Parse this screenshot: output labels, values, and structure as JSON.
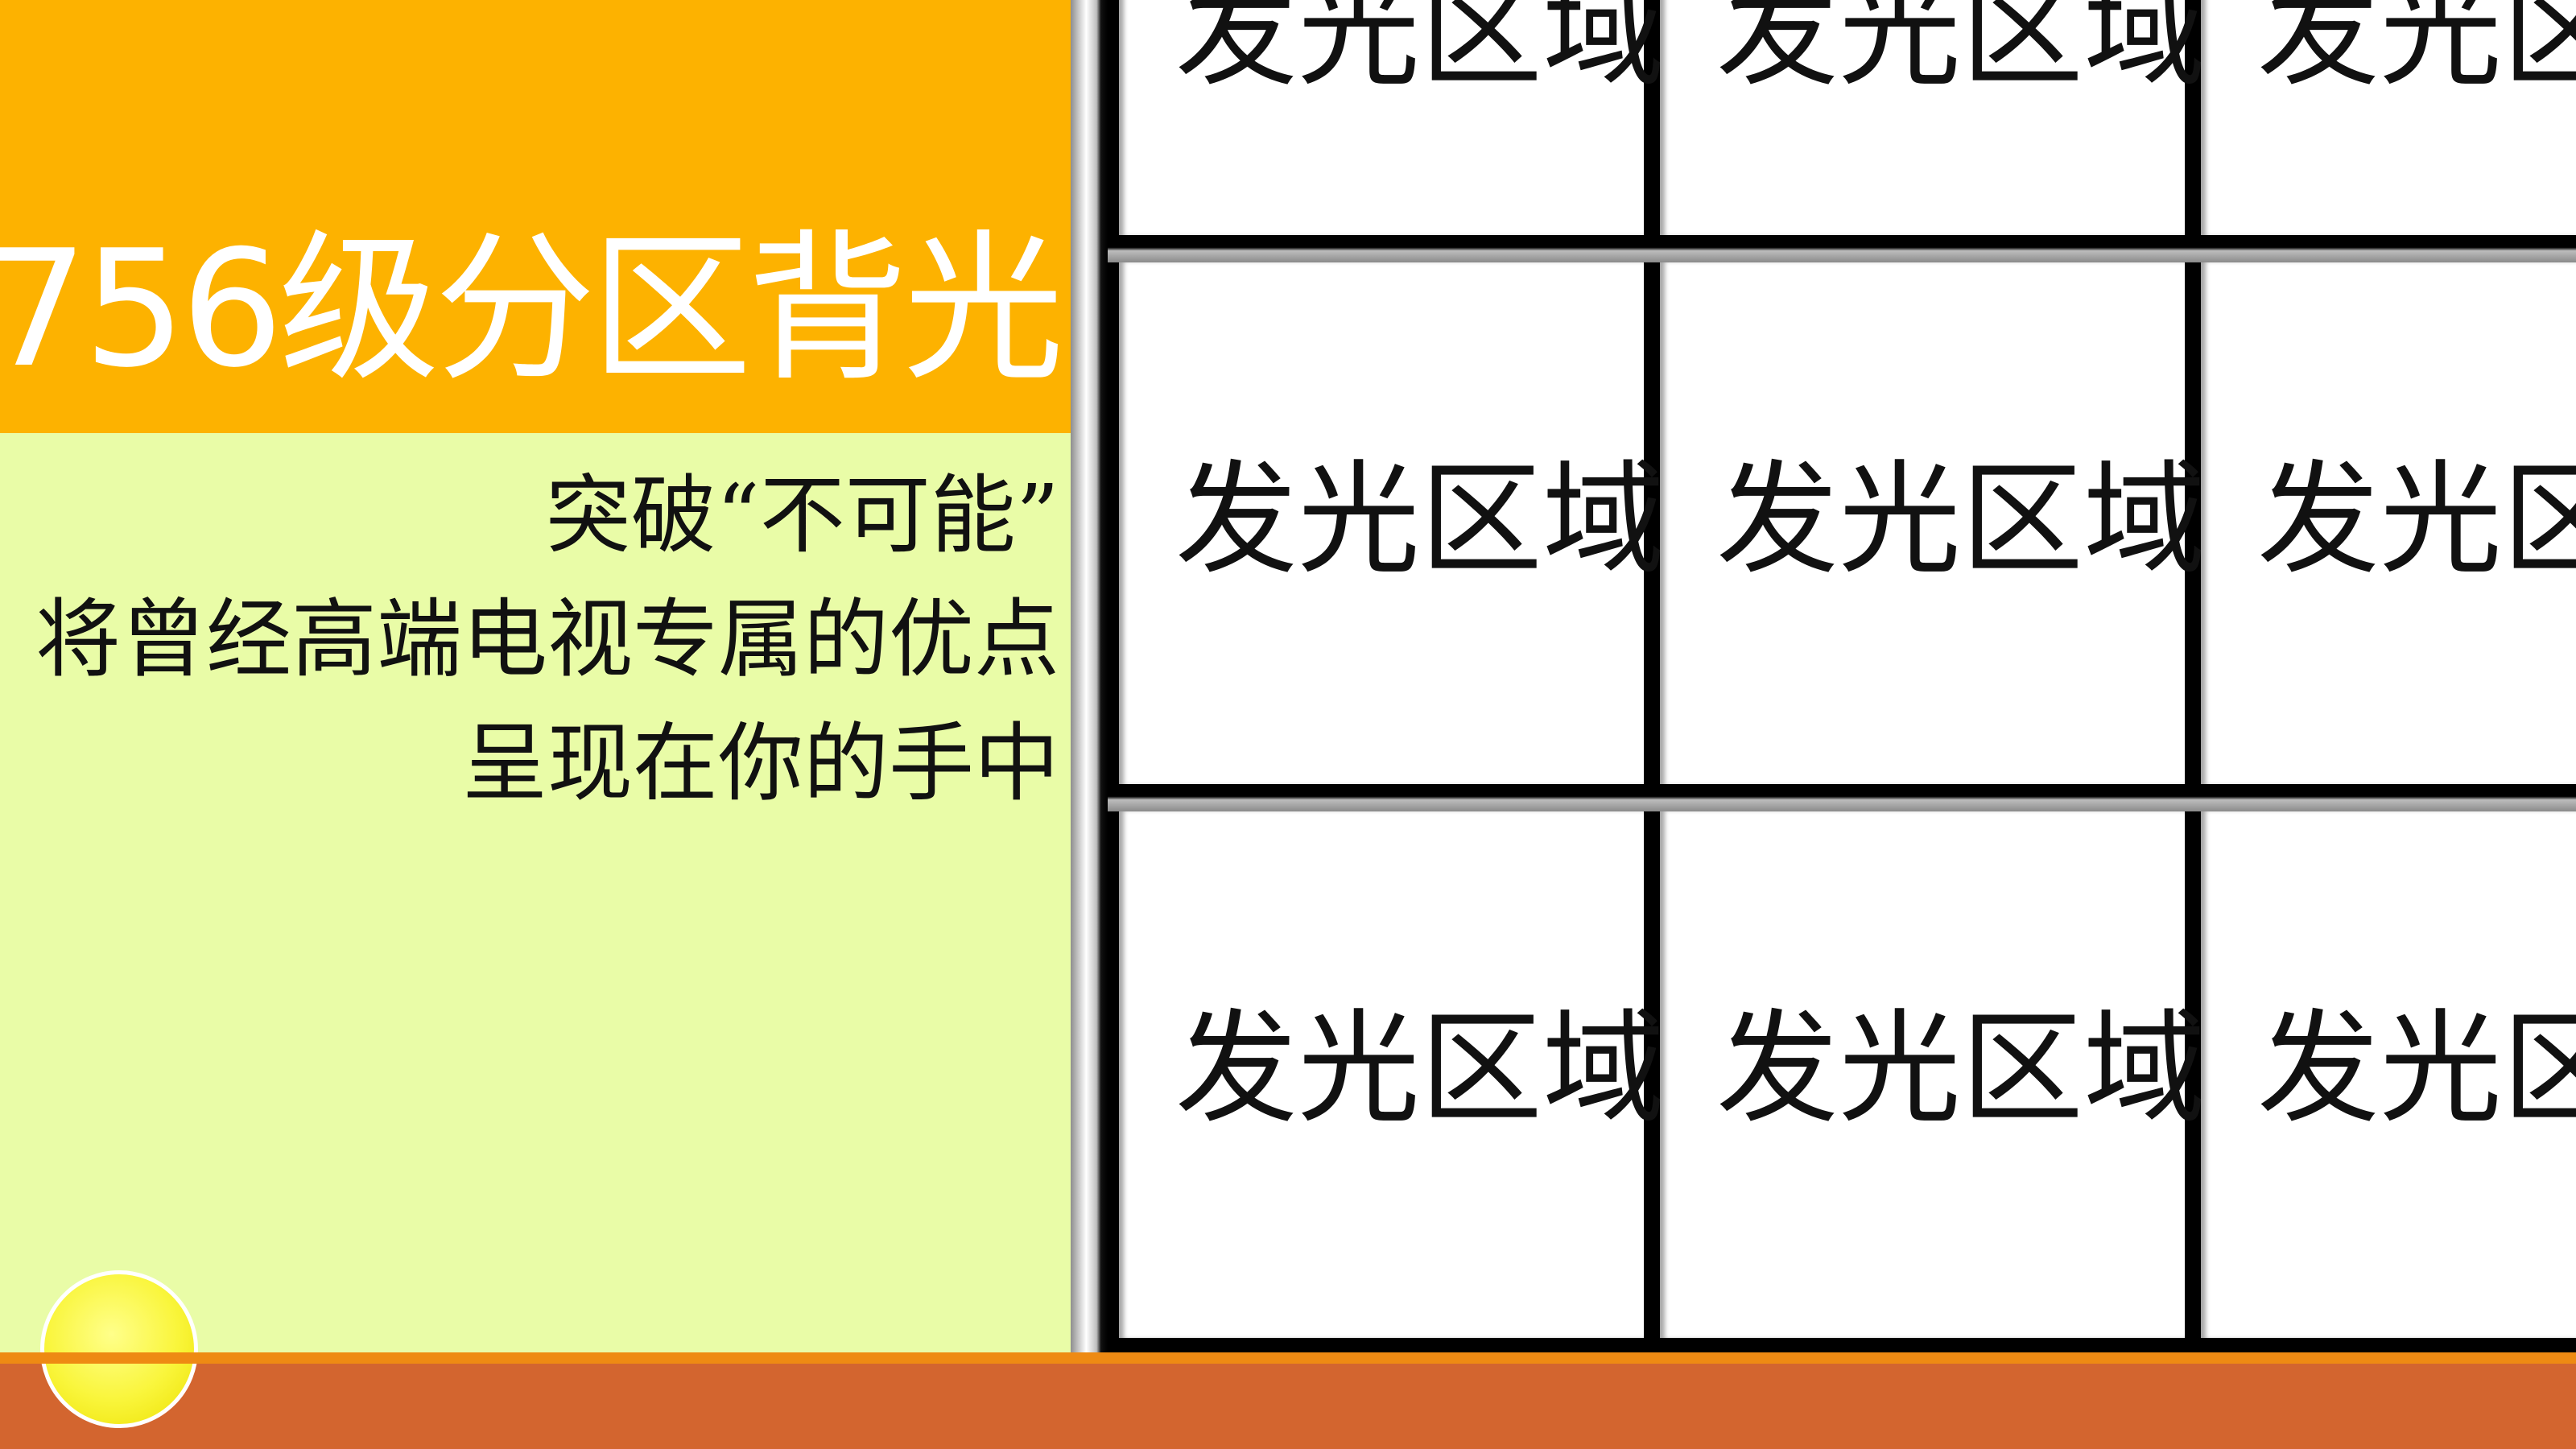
{
  "title": "756级分区背光",
  "description": {
    "lines": [
      "突破“不可能”",
      "将曾经高端电视专属的优点",
      "呈现在你的手中"
    ]
  },
  "grid": {
    "rows": [
      [
        "发光区域",
        "发光区域",
        "发光区域"
      ],
      [
        "发光区域",
        "发光区域",
        "发光区域"
      ],
      [
        "发光区域",
        "发光区域",
        "发光区域"
      ]
    ]
  },
  "colors": {
    "title_band": "#fdb200",
    "desc_band": "#e9fca7",
    "bottom_band": "#d3652f",
    "bottom_line": "#ee8a13",
    "orb": "#f9f53a"
  }
}
